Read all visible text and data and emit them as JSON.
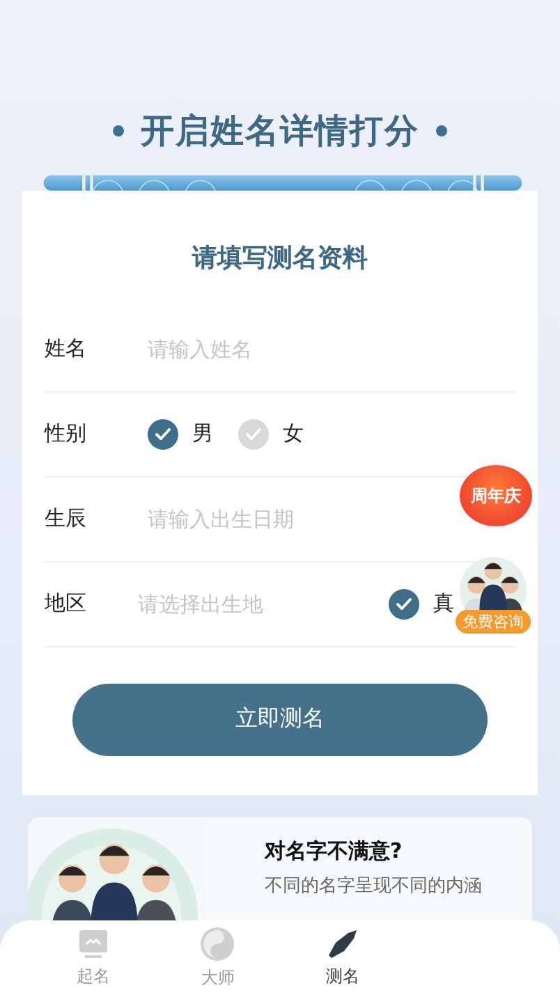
{
  "header": {
    "title": "开启姓名详情打分"
  },
  "form": {
    "title": "请填写测名资料",
    "fields": [
      {
        "kind": "input",
        "label": "姓名",
        "placeholder": "请输入姓名"
      },
      {
        "kind": "radio",
        "label": "性别",
        "options": [
          {
            "label": "男",
            "selected": true
          },
          {
            "label": "女",
            "selected": false
          }
        ]
      },
      {
        "kind": "input",
        "label": "生辰",
        "placeholder": "请输入出生日期"
      },
      {
        "kind": "input",
        "label": "地区",
        "placeholder": "请选择出生地",
        "option": {
          "label": "真",
          "checked": true
        }
      }
    ],
    "submit": "立即测名"
  },
  "promo": {
    "title": "对名字不满意?",
    "subtitle": "不同的名字呈现不同的内涵"
  },
  "badges": {
    "anniversary": "周年庆",
    "consult": "免费咨询"
  },
  "tabs": [
    {
      "label": "起名",
      "selected": false
    },
    {
      "label": "大师",
      "selected": false
    },
    {
      "label": "测名",
      "selected": true
    }
  ]
}
